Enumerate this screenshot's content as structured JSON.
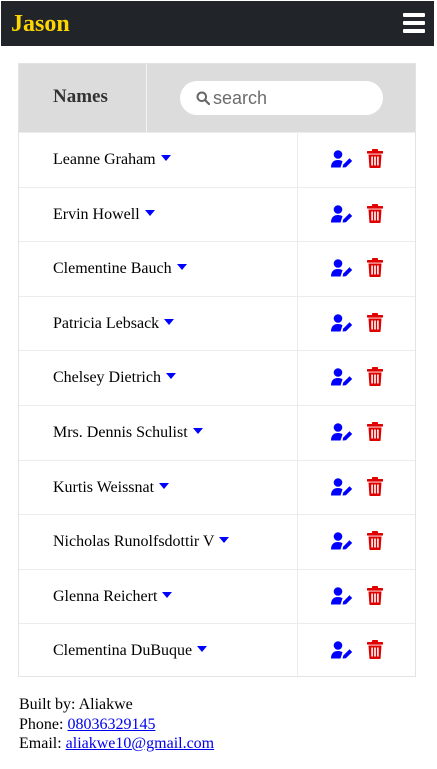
{
  "app": {
    "brand": "Jason",
    "brand_color": "#ffd700",
    "nav_bg": "#212529"
  },
  "table": {
    "header_label": "Names",
    "search_placeholder": "search",
    "search_value": "",
    "rows": [
      {
        "name": "Leanne Graham"
      },
      {
        "name": "Ervin Howell"
      },
      {
        "name": "Clementine Bauch"
      },
      {
        "name": "Patricia Lebsack"
      },
      {
        "name": "Chelsey Dietrich"
      },
      {
        "name": "Mrs. Dennis Schulist"
      },
      {
        "name": "Kurtis Weissnat"
      },
      {
        "name": "Nicholas Runolfsdottir V"
      },
      {
        "name": "Glenna Reichert"
      },
      {
        "name": "Clementina DuBuque"
      }
    ],
    "icons": {
      "edit": "user-edit-icon",
      "delete": "trash-icon",
      "caret": "caret-down-icon"
    },
    "colors": {
      "edit": "#0000ff",
      "delete": "#e00000"
    }
  },
  "footer": {
    "built_by_label": "Built by: ",
    "built_by": "Aliakwe",
    "phone_label": "Phone: ",
    "phone": "08036329145",
    "email_label": "Email: ",
    "email": "aliakwe10@gmail.com"
  }
}
